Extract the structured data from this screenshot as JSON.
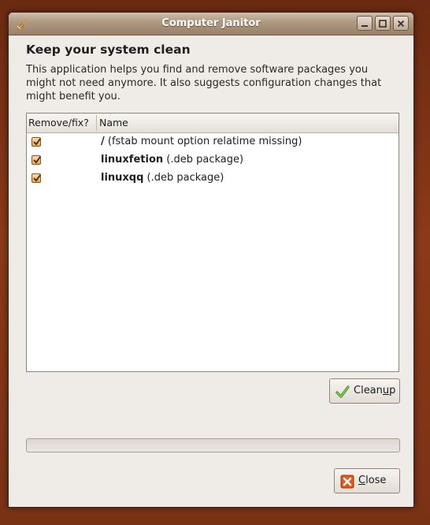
{
  "window": {
    "title": "Computer Janitor"
  },
  "main": {
    "heading": "Keep your system clean",
    "description": "This application helps you find and remove software packages you might not need anymore. It also suggests configuration changes that might benefit you."
  },
  "list": {
    "columns": [
      "Remove/fix?",
      "Name"
    ],
    "rows": [
      {
        "checked": true,
        "name": "/",
        "detail": " (fstab mount option relatime missing)"
      },
      {
        "checked": true,
        "name": "linuxfetion",
        "detail": " (.deb package)"
      },
      {
        "checked": true,
        "name": "linuxqq",
        "detail": " (.deb package)"
      }
    ]
  },
  "buttons": {
    "cleanup_pre": "Clean",
    "cleanup_mnemonic": "u",
    "cleanup_post": "p",
    "close_mnemonic": "C",
    "close_post": "lose"
  },
  "progress": {
    "value": 0
  },
  "icons": [
    "app-broom-icon",
    "minimize-icon",
    "maximize-icon",
    "close-window-icon",
    "checkmark-icon",
    "close-x-icon"
  ],
  "colors": {
    "accent": "#f4a34a",
    "window_bg": "#efebe7",
    "close_icon": "#e55a1c"
  }
}
